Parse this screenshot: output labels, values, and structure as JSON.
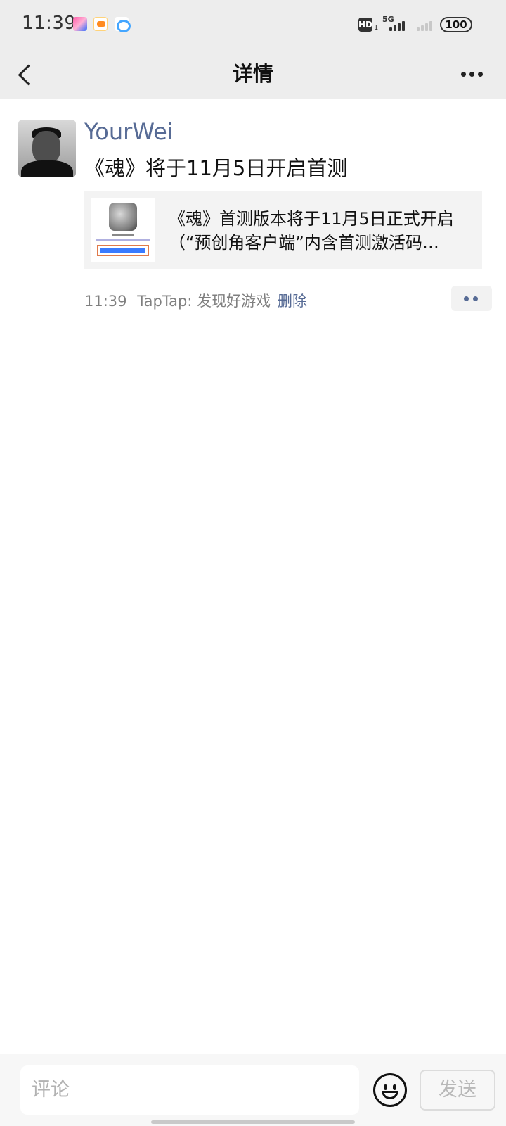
{
  "status_bar": {
    "time": "11:39",
    "hd_label": "HD",
    "hd_sub": "1",
    "network": "5G",
    "battery": "100"
  },
  "nav": {
    "title": "详情",
    "back_icon": "chevron-left-icon",
    "more_icon": "more-dots-icon"
  },
  "post": {
    "username": "YourWei",
    "text": "《魂》将于11月5日开启首测",
    "link_card": {
      "line1": "《魂》首测版本将于11月5日正式开启",
      "line2": "（“预创角客户端”内含首测激活码…"
    },
    "time": "11:39",
    "source": "TapTap: 发现好游戏",
    "delete_label": "删除"
  },
  "comment_bar": {
    "placeholder": "评论",
    "send_label": "发送",
    "emoji_icon": "smiley-icon"
  }
}
